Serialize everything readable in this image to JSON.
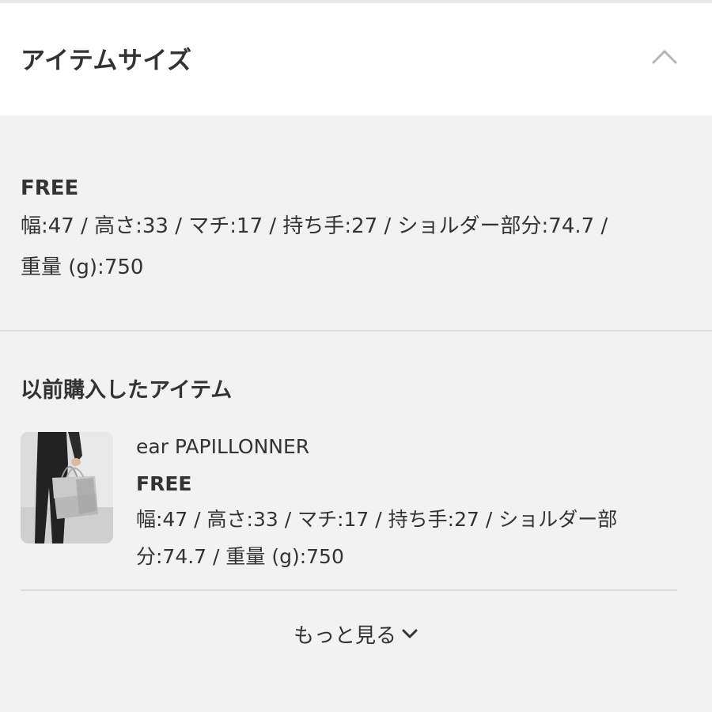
{
  "header": {
    "title": "アイテムサイズ",
    "toggle_icon": "chevron-up-icon"
  },
  "size_info": {
    "size_name": "FREE",
    "spec_line1": "幅:47 / 高さ:33 / マチ:17 / 持ち手:27 / ショルダー部分:74.7 /",
    "spec_line2": "重量 (g):750"
  },
  "previous_items": {
    "title": "以前購入したアイテム",
    "items": [
      {
        "brand": "ear PAPILLONNER",
        "size": "FREE",
        "spec_line1": "幅:47 / 高さ:33 / マチ:17 / 持ち手:27 / ショルダー部",
        "spec_line2": "分:74.7 / 重量 (g):750",
        "thumbnail_icon": "bag-photo"
      }
    ]
  },
  "more": {
    "label": "もっと見る",
    "icon": "chevron-down-icon"
  },
  "colors": {
    "background": "#f2f2f2",
    "header_bg": "#ffffff",
    "text": "#333333",
    "divider": "#e0e0e0"
  }
}
